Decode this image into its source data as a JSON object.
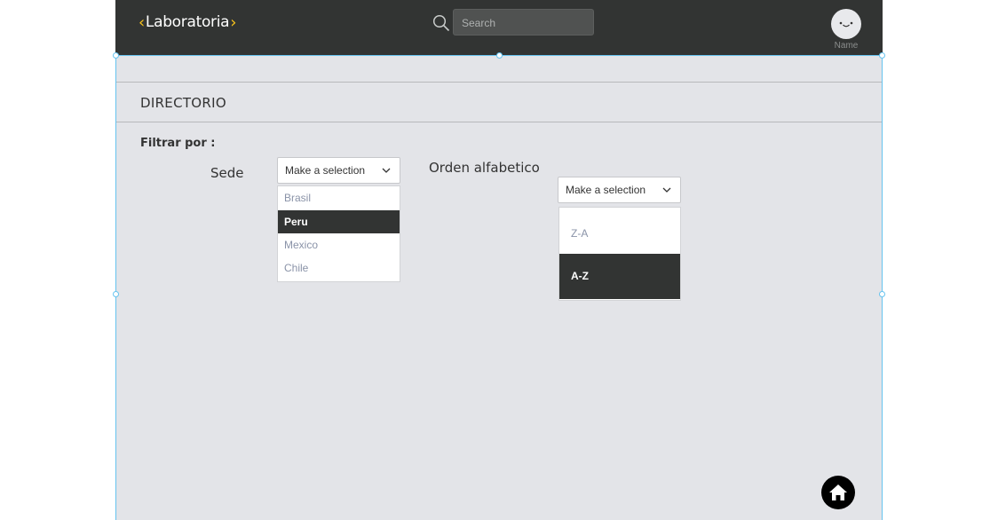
{
  "header": {
    "logo_text": "Laboratoria",
    "search_placeholder": "Search",
    "avatar_name": "Name"
  },
  "page": {
    "title": "DIRECTORIO",
    "filter_label": "Filtrar por :"
  },
  "filters": {
    "sede": {
      "label": "Sede",
      "selected": "Make a selection",
      "options": [
        "Brasil",
        "Peru",
        "Mexico",
        "Chile"
      ],
      "highlighted": "Peru"
    },
    "orden": {
      "label": "Orden alfabetico",
      "selected": "Make a selection",
      "options": [
        "Z-A",
        "A-Z"
      ],
      "highlighted": "A-Z"
    }
  },
  "colors": {
    "topbar": "#323433",
    "accent": "#f7c21b",
    "selection": "#66c3ef"
  }
}
